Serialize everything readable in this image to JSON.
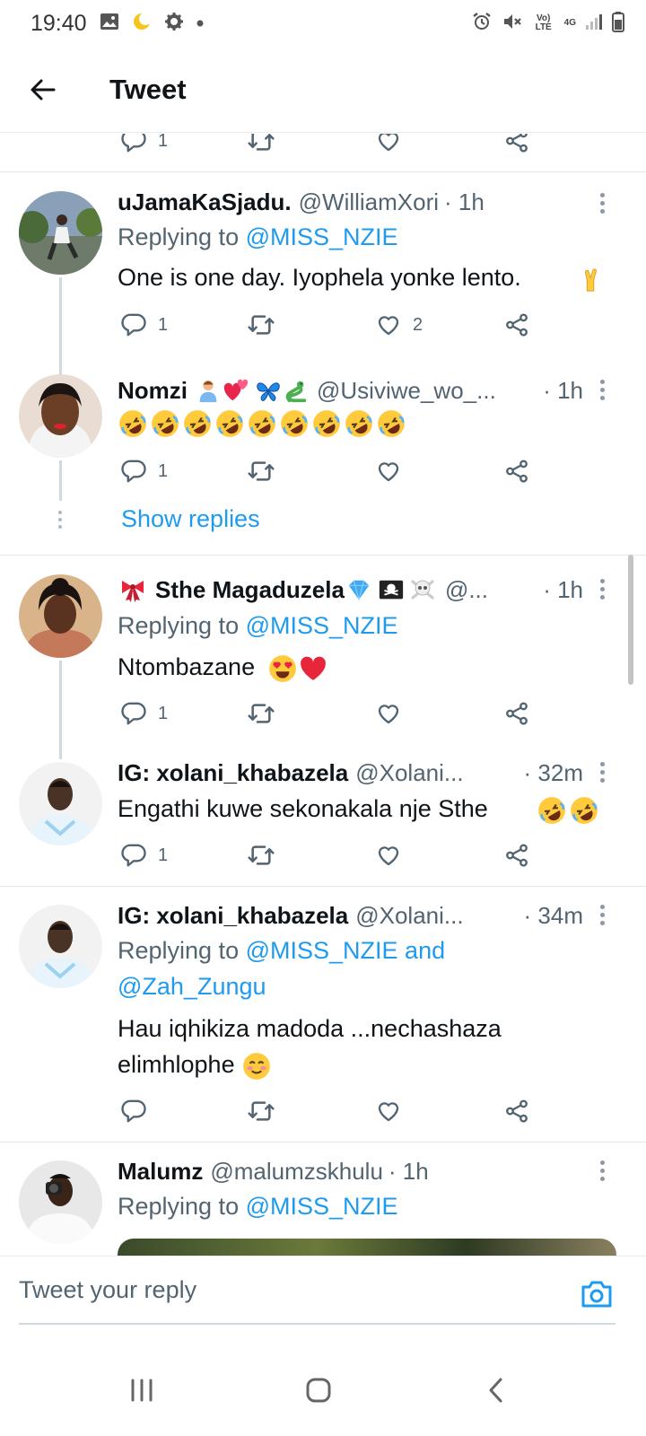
{
  "status_bar": {
    "time": "19:40",
    "network_label": "Vo) LTE",
    "network_type": "4G"
  },
  "header": {
    "title": "Tweet"
  },
  "top_partial": {
    "reply_count": "1"
  },
  "tweets": [
    {
      "name": "uJamaKaSjadu.",
      "handle": "@WilliamXori",
      "time": "· 1h",
      "replying_prefix": "Replying to",
      "replying_to": "@MISS_NZIE",
      "text": "One is one day. Iyophela yonke lento.",
      "emoji": [
        "crossed-fingers"
      ],
      "reply_count": "1",
      "like_count": "2"
    },
    {
      "name": "Nomzi",
      "name_emoji": [
        "person-icon",
        "hearts",
        "butterfly",
        "snake"
      ],
      "handle": "@Usiviwe_wo_...",
      "time": "· 1h",
      "text_emoji_count": 9,
      "reply_count": "1",
      "show_replies": "Show replies"
    },
    {
      "name_prefix_emoji": "ribbon",
      "name": "Sthe Magaduzela",
      "name_emoji": [
        "gem",
        "pirate-flag",
        "skull-crossbones"
      ],
      "handle": "@...",
      "time": "· 1h",
      "replying_prefix": "Replying to",
      "replying_to": "@MISS_NZIE",
      "text": "Ntombazane",
      "emoji": [
        "heart-eyes",
        "red-heart"
      ],
      "reply_count": "1"
    },
    {
      "name": "IG: xolani_khabazela",
      "handle": "@Xolani...",
      "time": "· 32m",
      "text": "Engathi kuwe sekonakala nje Sthe",
      "emoji": [
        "rofl",
        "rofl"
      ],
      "reply_count": "1"
    },
    {
      "name": "IG: xolani_khabazela",
      "handle": "@Xolani...",
      "time": "· 34m",
      "replying_prefix": "Replying to",
      "replying_to": "@MISS_NZIE and",
      "replying_to_2": "@Zah_Zungu",
      "text_line1": "Hau iqhikiza madoda ...nechashaza",
      "text_line2": "elimhlophe",
      "emoji": [
        "smiling-blush"
      ]
    },
    {
      "name": "Malumz",
      "handle": "@malumzskhulu",
      "time": "· 1h",
      "replying_prefix": "Replying to",
      "replying_to": "@MISS_NZIE"
    }
  ],
  "reply_bar": {
    "placeholder": "Tweet your reply"
  },
  "colors": {
    "accent": "#1d9bf0",
    "text": "#0f1419",
    "muted": "#536471",
    "divider": "#e1e8ed"
  }
}
